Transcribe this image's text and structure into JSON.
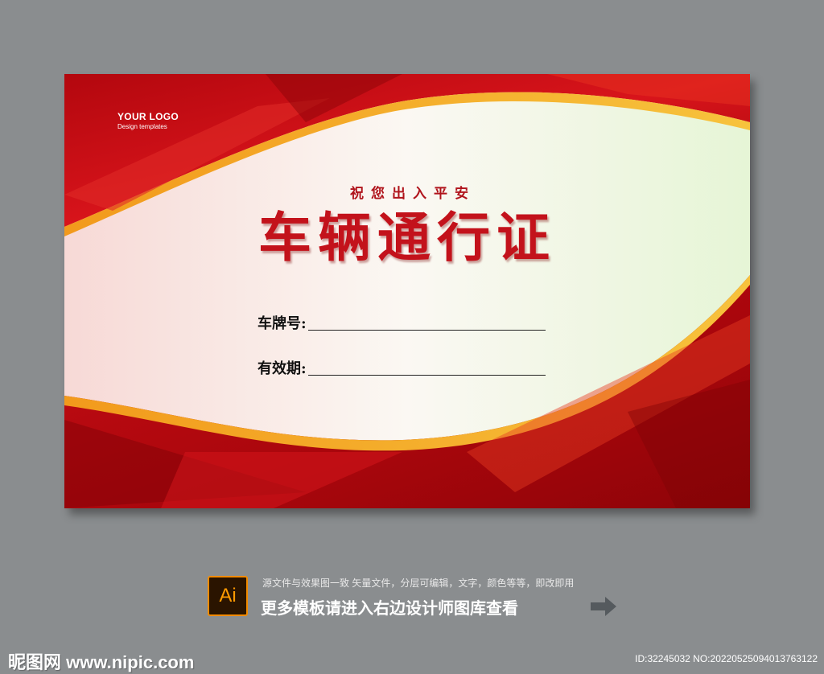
{
  "card": {
    "logo_title": "YOUR LOGO",
    "logo_subtitle": "Design templates",
    "blessing": "祝您出入平安",
    "title": "车辆通行证",
    "plate_label": "车牌号:",
    "validity_label": "有效期:"
  },
  "footer": {
    "ai_icon_text": "Ai",
    "description": "源文件与效果图一致 矢量文件，分层可编辑，文字，颜色等等，即改即用",
    "more_templates": "更多模板请进入右边设计师图库查看",
    "watermark": "昵图网 www.nipic.com",
    "image_id": "ID:32245032 NO:20220525094013763122"
  },
  "colors": {
    "background": "#8a8d8f",
    "brand_red": "#c3121b",
    "accent_orange": "#f28b00"
  },
  "icons": [
    "ai-file-icon",
    "arrow-right-icon"
  ]
}
